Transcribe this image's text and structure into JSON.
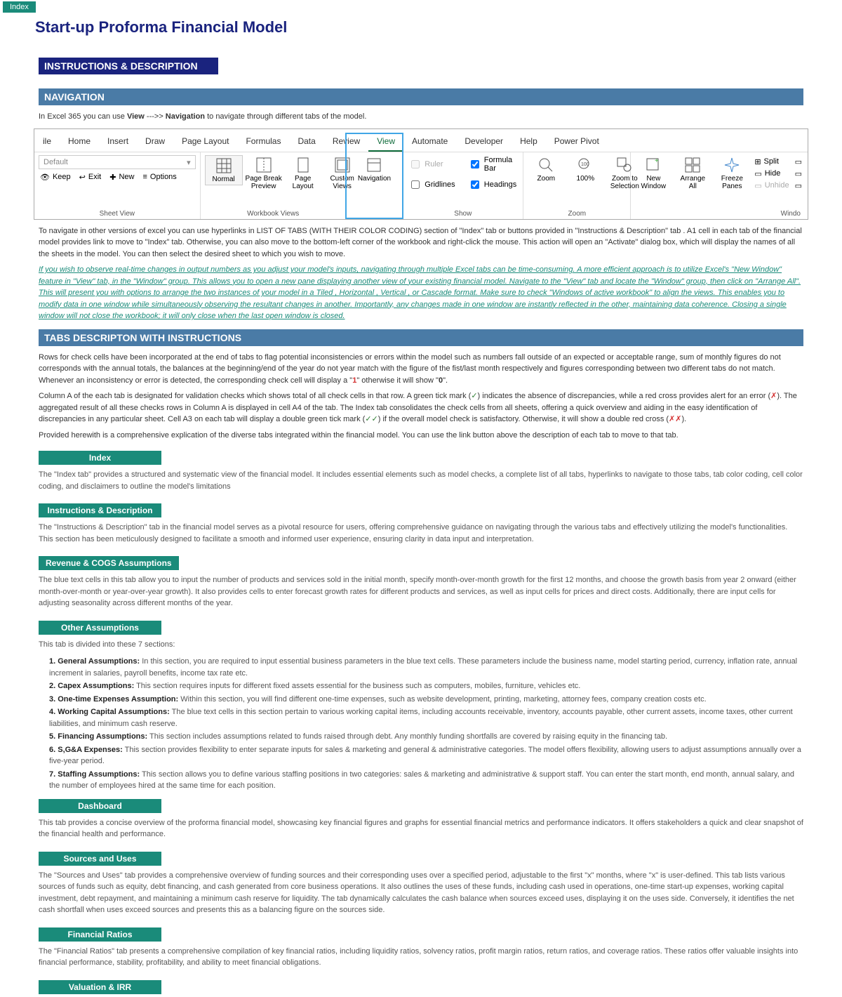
{
  "top_tab": "Index",
  "title": "Start-up Proforma Financial Model",
  "instructions_header": "INSTRUCTIONS & DESCRIPTION",
  "navigation_header": "NAVIGATION",
  "nav_intro_pre": "In Excel 365 you can use ",
  "nav_intro_bold1": "View",
  "nav_intro_mid": "  --->> ",
  "nav_intro_bold2": "Navigation",
  "nav_intro_post": " to navigate through different tabs of the model.",
  "ribbon": {
    "tabs": [
      "ile",
      "Home",
      "Insert",
      "Draw",
      "Page Layout",
      "Formulas",
      "Data",
      "Review",
      "View",
      "Automate",
      "Developer",
      "Help",
      "Power Pivot"
    ],
    "active_tab": "View",
    "sheet_view": {
      "dropdown": "Default",
      "keep": "Keep",
      "exit": "Exit",
      "new": "New",
      "options": "Options",
      "label": "Sheet View"
    },
    "workbook_views": {
      "normal": "Normal",
      "pagebreak": "Page Break\nPreview",
      "pagelayout": "Page\nLayout",
      "custom": "Custom\nViews",
      "label": "Workbook Views"
    },
    "navigation": {
      "btn": "Navigation"
    },
    "show": {
      "ruler": "Ruler",
      "formula_bar": "Formula Bar",
      "gridlines": "Gridlines",
      "headings": "Headings",
      "label": "Show"
    },
    "zoom": {
      "zoom": "Zoom",
      "p100": "100%",
      "selection": "Zoom to\nSelection",
      "label": "Zoom"
    },
    "window": {
      "new": "New\nWindow",
      "arrange": "Arrange\nAll",
      "freeze": "Freeze\nPanes",
      "split": "Split",
      "hide": "Hide",
      "unhide": "Unhide",
      "label": "Windo"
    }
  },
  "nav_para2": "To navigate in other versions of excel you can use hyperlinks in LIST OF TABS (WITH THEIR COLOR CODING) section of \"Index\" tab or buttons provided in  \"Instructions & Description\" tab . A1 cell in each tab of the financial model provides link to move to \"Index\" tab. Otherwise, you can also move to the bottom-left corner of the workbook and right-click the mouse. This action will open an \"Activate\" dialog box, which will display the names of all the sheets in the model. You can then select the desired sheet to which you wish to move.",
  "nav_para3": "If you wish to observe real-time changes in output numbers as you adjust your model's inputs, navigating through multiple Excel tabs can be time-consuming. A more efficient approach is to utilize Excel's \"New Window\" feature in \"View\" tab, in the \"Window\" group. This allows you to open a new pane displaying another view of your existing financial model. Navigate to the \"View\" tab and locate the \"Window\" group, then click on \"Arrange All\".   This will present you with options to arrange the two instances of your model in a  Tiled ,  Horizontal ,  Vertical , or  Cascade  format. Make sure to check \"Windows of active workbook\" to align the views. This  enables you to modify data in one window while simultaneously observing the resultant changes in another. Importantly, any changes made in one window are instantly reflected in the other, maintaining data coherence. Closing a single window will not close the workbook; it will only close when the last open window is closed.",
  "tabs_desc_header": "TABS DESCRIPTON WITH INSTRUCTIONS",
  "tabs_desc_p1_a": "Rows for check cells have been incorporated at the end of tabs to flag potential inconsistencies or errors within the model such as numbers fall outside of an expected or acceptable range, sum of monthly figures do not corresponds with the annual totals, the balances at the beginning/end of the year do not year match with the figure of the fist/last month respectively and figures corresponding between two different tabs do not match. Whenever an inconsistency or error is detected, the corresponding check cell will display a \"",
  "tabs_desc_p1_1": "1",
  "tabs_desc_p1_b": "\" otherwise it will show \"",
  "tabs_desc_p1_0": "0",
  "tabs_desc_p1_c": "\".",
  "tabs_desc_p2_a": "Column A of the each tab is designated for validation checks which shows total of all check cells in that row. A green tick mark (",
  "tabs_desc_p2_tick": "✓",
  "tabs_desc_p2_b": ") indicates the absence of discrepancies, while a red cross provides alert for an error (",
  "tabs_desc_p2_x": "✗",
  "tabs_desc_p2_c": "). The aggregated result of all these checks rows in Column A is displayed in cell A4 of the tab. The Index tab consolidates the check cells from all sheets, offering a quick overview and aiding in the easy identification of discrepancies in any particular sheet. Cell A3 on each tab will display a double green tick mark (",
  "tabs_desc_p2_dtick": "✓✓",
  "tabs_desc_p2_d": ") if the overall model check is satisfactory. Otherwise, it will show a double red cross (",
  "tabs_desc_p2_dx": "✗✗",
  "tabs_desc_p2_e": ").",
  "tabs_desc_p3": "Provided herewith is a comprehensive explication of the diverse tabs integrated within the financial model. You can use the link button above the description of each tab to move to that tab.",
  "tabs": {
    "index": {
      "btn": "Index",
      "desc": "The \"Index tab\" provides a structured and systematic view of the financial model. It includes essential elements such as model checks, a complete list of all tabs, hyperlinks to navigate to those tabs, tab color coding, cell color coding, and disclaimers to outline the model's limitations"
    },
    "instructions": {
      "btn": "Instructions & Description",
      "desc": "The \"Instructions & Description\" tab in the financial model serves as a pivotal resource for users, offering comprehensive guidance on navigating through the various tabs and effectively utilizing the model's functionalities. This section has been meticulously designed to facilitate a smooth and informed user experience, ensuring clarity in data input and interpretation."
    },
    "revenue": {
      "btn": "Revenue & COGS Assumptions",
      "desc": "The blue text cells in this tab allow you to input the number of products and services sold in the initial month, specify month-over-month growth for the first 12 months, and choose the growth basis from year 2 onward (either month-over-month or year-over-year growth). It also provides cells to enter forecast growth rates for different products and services, as well as input cells for prices and direct costs. Additionally, there are input cells for adjusting seasonality across different months of the year."
    },
    "other": {
      "btn": "Other Assumptions",
      "intro": "This tab is divided into these 7 sections:",
      "items": [
        {
          "b": "1. General Assumptions:",
          "t": " In this section, you are required to input essential business parameters in the blue text cells. These parameters include the business name, model starting period, currency, inflation rate, annual increment in salaries, payroll benefits, income tax rate etc."
        },
        {
          "b": "2. Capex Assumptions:",
          "t": " This section requires inputs for different fixed assets essential for the business such as computers, mobiles, furniture, vehicles etc."
        },
        {
          "b": "3. One-time Expenses Assumption:",
          "t": " Within this section, you will find different one-time expenses, such as website development, printing, marketing, attorney fees, company creation costs etc."
        },
        {
          "b": "4. Working Capital Assumptions:",
          "t": " The blue text cells in this section pertain to various working capital items, including accounts receivable, inventory, accounts payable, other current assets, income taxes, other current liabilities, and minimum cash reserve."
        },
        {
          "b": "5. Financing Assumptions:",
          "t": " This section includes assumptions related to funds raised through debt. Any monthly funding shortfalls are covered by raising equity in the financing tab."
        },
        {
          "b": "6. S,G&A Expenses:",
          "t": " This section provides flexibility to enter separate inputs for sales & marketing and general & administrative categories.  The model offers flexibility, allowing users to adjust assumptions annually  over a  five-year period."
        },
        {
          "b": "7. Staffing Assumptions:",
          "t": " This section allows you to define various staffing positions in two categories: sales & marketing and administrative & support staff. You can enter the start month, end month, annual salary, and the number of employees hired at the same time for each position."
        }
      ]
    },
    "dashboard": {
      "btn": "Dashboard",
      "desc": "This tab provides a concise overview of the proforma financial model, showcasing key financial figures and graphs for essential financial metrics and performance indicators. It offers stakeholders a quick and clear snapshot of the financial health and performance."
    },
    "sources": {
      "btn": "Sources and Uses",
      "desc": "The \"Sources and Uses\" tab provides a comprehensive overview of funding sources and their corresponding uses over a specified period, adjustable to the first \"x\" months, where \"x\" is user-defined. This tab lists various sources of funds such as equity, debt financing, and cash generated from core business operations. It also outlines the uses of these funds, including cash used in operations, one-time start-up expenses, working capital investment, debt repayment, and maintaining  a minimum cash reserve for liquidity. The tab dynamically calculates the cash balance when sources exceed uses, displaying it on the uses side. Conversely, it identifies the net cash shortfall when uses exceed sources and presents this as a balancing figure on the sources side."
    },
    "ratios": {
      "btn": "Financial Ratios",
      "desc": "The \"Financial Ratios\" tab presents a comprehensive compilation of key financial ratios, including liquidity ratios, solvency ratios, profit margin ratios, return ratios, and coverage ratios. These ratios offer valuable insights into financial performance, stability, profitability, and ability to meet financial obligations."
    },
    "valuation": {
      "btn": "Valuation & IRR"
    }
  }
}
